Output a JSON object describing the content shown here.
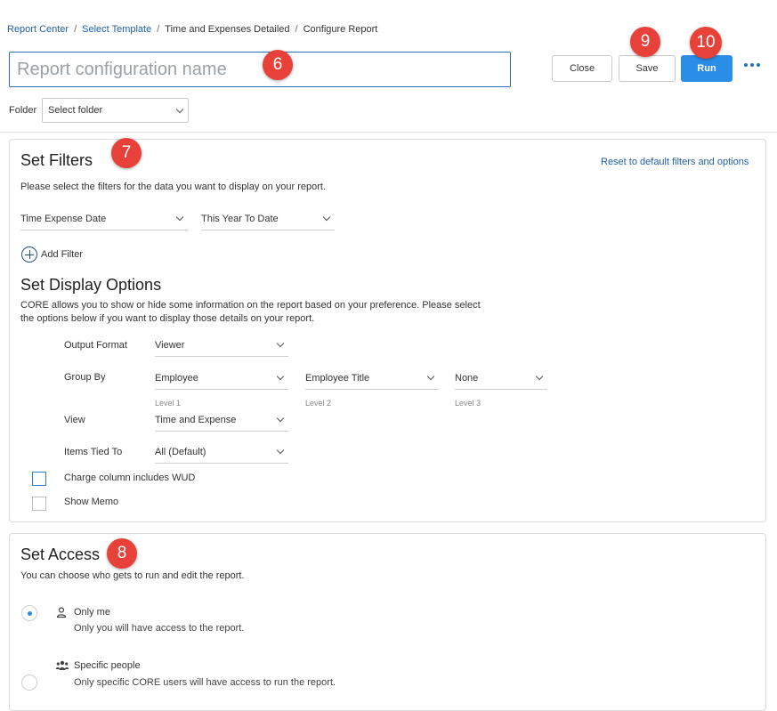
{
  "breadcrumb": [
    "Report Center",
    "Select Template",
    "Time and Expenses Detailed",
    "Configure Report"
  ],
  "name_input": {
    "placeholder": "Report configuration name"
  },
  "toolbar": {
    "close": "Close",
    "save": "Save",
    "run": "Run"
  },
  "badges": {
    "name": "6",
    "filters": "7",
    "access": "8",
    "save": "9",
    "run": "10"
  },
  "folder": {
    "label": "Folder",
    "value": "Select folder"
  },
  "filters": {
    "title": "Set Filters",
    "reset_link": "Reset to default filters and options",
    "description": "Please select the filters for the data you want to display on your report.",
    "field": "Time Expense Date",
    "range": "This Year To Date",
    "add_filter": "Add Filter"
  },
  "display": {
    "title": "Set Display Options",
    "description_line1": "CORE allows you to show or hide some information on the report based on your preference. Please select",
    "description_line2": "the options below if you want to display those details on your report.",
    "output_format": {
      "label": "Output Format",
      "value": "Viewer"
    },
    "group_by": {
      "label": "Group By",
      "level1": "Employee",
      "level1_label": "Level 1",
      "level2": "Employee Title",
      "level2_label": "Level 2",
      "level3": "None",
      "level3_label": "Level 3"
    },
    "view": {
      "label": "View",
      "value": "Time and Expense"
    },
    "items_tied_to": {
      "label": "Items Tied To",
      "value": "All (Default)"
    },
    "charge_wud": "Charge column includes WUD",
    "show_memo": "Show Memo"
  },
  "access": {
    "title": "Set Access",
    "description": "You can choose who gets to run and edit the report.",
    "options": [
      {
        "label": "Only me",
        "desc": "Only you will have access to the report.",
        "selected": true,
        "icon": "person-icon"
      },
      {
        "label": "Specific people",
        "desc": "Only specific CORE users will have access to run the report.",
        "selected": false,
        "icon": "people-icon"
      }
    ]
  },
  "colors": {
    "accent": "#2a8de6",
    "badge": "#e8413a",
    "link": "#1f5fa8"
  }
}
